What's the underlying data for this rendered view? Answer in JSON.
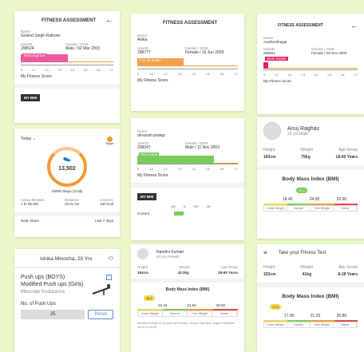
{
  "card1": {
    "title": "FITNESS ASSESSMENT",
    "name_label": "Name",
    "name": "Govind Singh Rathore",
    "id_label": "UserID",
    "id": "298524",
    "gender_label": "Gender / DOB",
    "gender_dob": "Male / 02 Mar 2003",
    "status": "Must improve",
    "status_color": "#ee5b9b",
    "ticks": [
      "0",
      "L1",
      "L2",
      "L3",
      "L4",
      "L5",
      "L6",
      "L7"
    ],
    "score_label": "My Fitness Score",
    "bmi_btn": "MY BMI"
  },
  "card2": {
    "title": "FITNESS ASSESSMENT",
    "name_label": "Name",
    "name": "Anika",
    "id_label": "UserID",
    "id": "288777",
    "gender_label": "Gender / DOB",
    "gender_dob": "Female / 16 Jun 2003",
    "status": "Can do better",
    "status_color": "#f5a04b",
    "ticks": [
      "0",
      "L1",
      "L2",
      "L3",
      "L4",
      "L5",
      "L6",
      "L7"
    ],
    "score_label": "My Fitness Score"
  },
  "card3": {
    "title": "FITNESS ASSESSMENT",
    "name_label": "Name",
    "name": "Aastha Bhagat",
    "id_label": "UserID",
    "id": "298821",
    "gender_label": "Gender / DOB",
    "gender_dob": "Female / 08 Nov 2003",
    "status": "Work harder",
    "status_color": "#e02060",
    "ticks": [
      "0",
      "L1",
      "L2",
      "L3",
      "L4",
      "L5",
      "L6",
      "L7"
    ],
    "score_label": "My Fitness Score"
  },
  "card4": {
    "today": "Today",
    "target": "Target",
    "steps": "13,502",
    "steps_sub": "10000 Steps (Goal)",
    "stats": [
      {
        "label": "Active Minutes",
        "value": "1 hr 56 Min"
      },
      {
        "label": "Distance",
        "value": "10.01 km"
      },
      {
        "label": "Calories",
        "value": "440 kcal"
      }
    ],
    "daily": "Daily Steps",
    "last": "Last 7 days"
  },
  "card5": {
    "name_label": "Name",
    "name": "devansh pratap",
    "id_label": "UserID",
    "id": "298047",
    "gender_label": "Gender / DOB",
    "gender_dob": "Male / 11 Nov 2003",
    "status": "Very Good",
    "status_color": "#7ccb5e",
    "ticks": [
      "0",
      "L1",
      "L2",
      "L3",
      "L4",
      "L5",
      "L6",
      "L7"
    ],
    "score_label": "My Fitness Score",
    "bmi_btn": "MY BMI",
    "table_head": [
      "UW",
      "N",
      "OW",
      "OB"
    ],
    "current": "Current"
  },
  "card6": {
    "name": "Anuj Raghav",
    "age": "20 yrs,Male",
    "heads": [
      "Height",
      "Weight",
      "Age Group"
    ],
    "vals": [
      "183cm",
      "75kg",
      "18-65 Years"
    ],
    "bmi_title": "Body Mass Index (BMI)",
    "value": "22.4",
    "points": [
      "18.40",
      "24.90",
      "29.90"
    ],
    "cats": [
      "Under Weight",
      "Normal",
      "Over Weight",
      "Obese"
    ]
  },
  "card7": {
    "name": "Ishika Minocha, 20 Yrs",
    "exercise": "Push ups (BOYS) Modified Push ups (Girls)",
    "category": "Muscular Endurance",
    "count_label": "No. of Push Ups",
    "count": "25",
    "reset": "Reset"
  },
  "card8": {
    "name": "Nandini Kumari",
    "age": "20 yrs,Female",
    "heads": [
      "Height",
      "Weight",
      "Age Group"
    ],
    "vals": [
      "164cm",
      "43.3kg",
      "18-65 Years"
    ],
    "bmi_title": "Body Mass Index (BMI)",
    "value": "16.1",
    "points": [
      "18.40",
      "24.90",
      "29.90"
    ],
    "cats": [
      "Under Weight",
      "Normal",
      "Over Weight",
      "Obese"
    ],
    "note": "Nandini Kumari is 20 year old Female, whose total BMI range is between 18.40 to 24.90."
  },
  "card9": {
    "title": "Take your Fitness Test",
    "heads": [
      "Height",
      "Weight",
      "Age Group"
    ],
    "vals": [
      "153cm",
      "41kg",
      "8-18 Years"
    ],
    "bmi_title": "Body Mass Index (BMI)",
    "value": "17.5",
    "points": [
      "17.80",
      "21.20",
      "25.80"
    ],
    "cats": [
      "Under Weight",
      "Normal",
      "Over Weight",
      "Obese"
    ]
  },
  "colors": {
    "background": "#eaf7c8",
    "orange": "#f39a35",
    "green": "#7ccb5e",
    "yellow": "#f3d64d",
    "red": "#e94b4b"
  }
}
